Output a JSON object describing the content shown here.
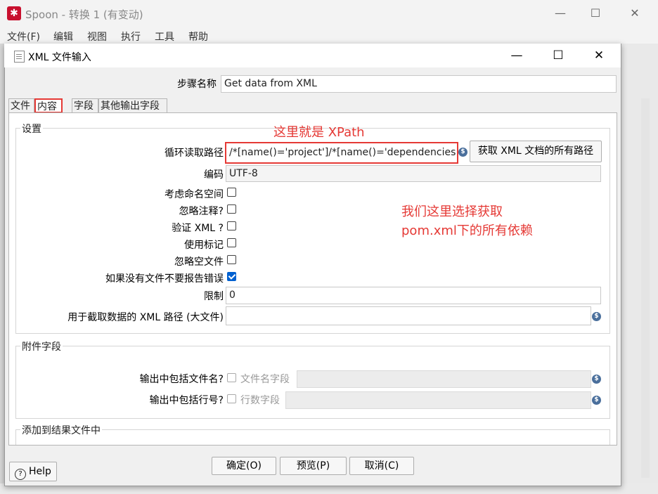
{
  "app": {
    "title": "Spoon - 转换 1 (有变动)",
    "menu": [
      "文件(F)",
      "编辑",
      "视图",
      "执行",
      "工具",
      "帮助"
    ],
    "window_controls": {
      "minimize": "—",
      "maximize": "☐",
      "close": "✕"
    }
  },
  "dialog": {
    "title": "XML 文件输入",
    "controls": {
      "minimize": "—",
      "maximize": "☐",
      "close": "✕"
    },
    "step_name_label": "步骤名称",
    "step_name_value": "Get data from XML",
    "tabs": [
      "文件",
      "内容",
      "字段",
      "其他输出字段"
    ],
    "active_tab": "内容",
    "settings": {
      "group_title": "设置",
      "loop_path_label": "循环读取路径",
      "loop_path_value": "/*[name()='project']/*[name()='dependencies",
      "get_paths_button": "获取 XML 文档的所有路径",
      "encoding_label": "编码",
      "encoding_value": "UTF-8",
      "namespace_label": "考虑命名空间",
      "namespace_checked": false,
      "ignore_comments_label": "忽略注释?",
      "ignore_comments_checked": false,
      "validate_label": "验证 XML ?",
      "validate_checked": false,
      "use_token_label": "使用标记",
      "use_token_checked": false,
      "ignore_empty_label": "忽略空文件",
      "ignore_empty_checked": false,
      "no_file_error_label": "如果没有文件不要报告错误",
      "no_file_error_checked": true,
      "limit_label": "限制",
      "limit_value": "0",
      "prune_path_label": "用于截取数据的 XML 路径 (大文件)",
      "prune_path_value": ""
    },
    "additional_fields": {
      "group_title": "附件字段",
      "include_filename_label": "输出中包括文件名?",
      "filename_field_label": "文件名字段",
      "include_rownum_label": "输出中包括行号?",
      "rownum_field_label": "行数字段"
    },
    "result_files": {
      "group_title": "添加到结果文件中"
    },
    "buttons": {
      "ok": "确定(O)",
      "preview": "预览(P)",
      "cancel": "取消(C)",
      "help": "Help"
    }
  },
  "annotations": {
    "xpath_note": "这里就是 XPath",
    "select_note_line1": "我们这里选择获取",
    "select_note_line2": "pom.xml下的所有依赖"
  },
  "colors": {
    "annotation": "#e53935",
    "checkbox_accent": "#0060d0",
    "app_icon": "#c8102e"
  }
}
